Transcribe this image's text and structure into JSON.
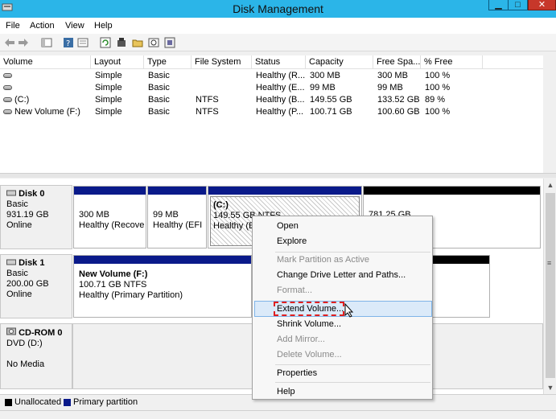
{
  "window": {
    "title": "Disk Management"
  },
  "menubar": {
    "items": [
      "File",
      "Action",
      "View",
      "Help"
    ]
  },
  "toolbar": {
    "icons": [
      "back-icon",
      "forward-icon",
      "console-tree-icon",
      "help-icon",
      "properties-icon",
      "refresh-icon",
      "rescan-icon",
      "open-folder-icon",
      "explore-icon",
      "settings-icon"
    ]
  },
  "volume_list": {
    "columns": [
      "Volume",
      "Layout",
      "Type",
      "File System",
      "Status",
      "Capacity",
      "Free Spa...",
      "% Free"
    ],
    "rows": [
      {
        "volume": "",
        "layout": "Simple",
        "type": "Basic",
        "fs": "",
        "status": "Healthy (R...",
        "capacity": "300 MB",
        "free": "300 MB",
        "pct": "100 %"
      },
      {
        "volume": "",
        "layout": "Simple",
        "type": "Basic",
        "fs": "",
        "status": "Healthy (E...",
        "capacity": "99 MB",
        "free": "99 MB",
        "pct": "100 %"
      },
      {
        "volume": "(C:)",
        "layout": "Simple",
        "type": "Basic",
        "fs": "NTFS",
        "status": "Healthy (B...",
        "capacity": "149.55 GB",
        "free": "133.52 GB",
        "pct": "89 %"
      },
      {
        "volume": "New Volume (F:)",
        "layout": "Simple",
        "type": "Basic",
        "fs": "NTFS",
        "status": "Healthy (P...",
        "capacity": "100.71 GB",
        "free": "100.60 GB",
        "pct": "100 %"
      }
    ]
  },
  "disks": {
    "disk0": {
      "name": "Disk 0",
      "type": "Basic",
      "size": "931.19 GB",
      "status": "Online",
      "p1_size": "300 MB",
      "p1_status": "Healthy (Recover",
      "p2_size": "99 MB",
      "p2_status": "Healthy (EFI S",
      "p3_name": "(C:)",
      "p3_size": "149.55 GB NTFS",
      "p3_status": "Healthy (B",
      "p4_size": "781.25 GB"
    },
    "disk1": {
      "name": "Disk 1",
      "type": "Basic",
      "size": "200.00 GB",
      "status": "Online",
      "p1_name": "New Volume  (F:)",
      "p1_size": "100.71 GB NTFS",
      "p1_status": "Healthy (Primary Partition)"
    },
    "cdrom": {
      "name": "CD-ROM 0",
      "type": "DVD (D:)",
      "status": "No Media"
    }
  },
  "legend": {
    "unallocated": "Unallocated",
    "primary": "Primary partition",
    "unallocated_color": "#000000",
    "primary_color": "#0a1a8a"
  },
  "context_menu": {
    "open": "Open",
    "explore": "Explore",
    "mark_active": "Mark Partition as Active",
    "change_letter": "Change Drive Letter and Paths...",
    "format": "Format...",
    "extend": "Extend Volume...",
    "shrink": "Shrink Volume...",
    "add_mirror": "Add Mirror...",
    "delete": "Delete Volume...",
    "properties": "Properties",
    "help": "Help"
  }
}
